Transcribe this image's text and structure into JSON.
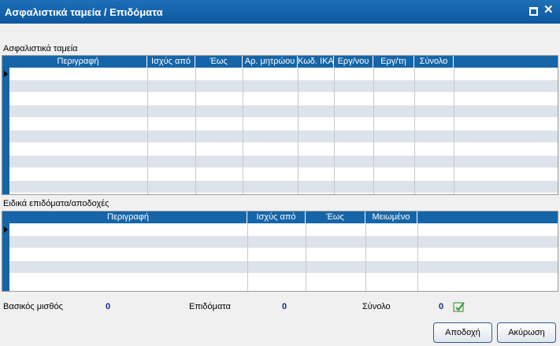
{
  "window": {
    "title": "Ασφαλιστικά ταμεία / Επιδόματα"
  },
  "funds": {
    "label": "Ασφαλιστικά ταμεία",
    "columns": [
      "Περιγραφή",
      "Ισχύς από",
      "Έως",
      "Αρ. μητρώου",
      "Κωδ. ΙΚΑ",
      "Εργ/νου",
      "Εργ/τη",
      "Σύνολο"
    ]
  },
  "benefits": {
    "label": "Ειδικά επιδόματα/αποδοχές",
    "columns": [
      "Περιγραφή",
      "Ισχύς από",
      "Έως",
      "Μειωμένο"
    ]
  },
  "summary": {
    "basic_salary_label": "Βασικός μισθός",
    "basic_salary_value": "0",
    "benefits_label": "Επιδόματα",
    "benefits_value": "0",
    "total_label": "Σύνολο",
    "total_value": "0"
  },
  "buttons": {
    "accept": "Αποδοχή",
    "cancel": "Ακύρωση"
  },
  "colors": {
    "titlebar": "#0c58a1",
    "header": "#1565a8",
    "alt_row": "#dde3ea"
  }
}
